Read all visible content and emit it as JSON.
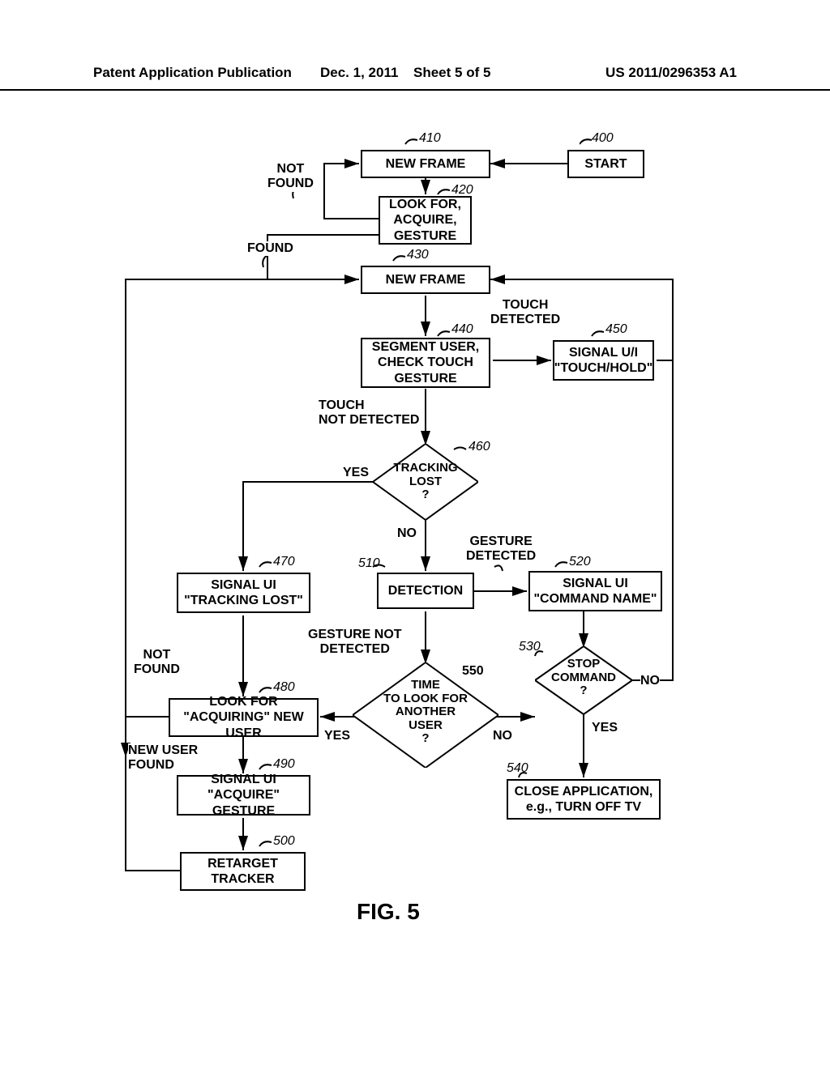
{
  "header": {
    "left": "Patent Application Publication",
    "date": "Dec. 1, 2011",
    "sheet": "Sheet 5 of 5",
    "pubnum": "US 2011/0296353 A1"
  },
  "figure_label": "FIG. 5",
  "nodes": {
    "n400": "START",
    "n410": "NEW FRAME",
    "n420": "LOOK FOR,\nACQUIRE,\nGESTURE",
    "n430": "NEW FRAME",
    "n440": "SEGMENT USER,\nCHECK TOUCH\nGESTURE",
    "n450": "SIGNAL U/I\n\"TOUCH/HOLD\"",
    "n460": "TRACKING\nLOST\n?",
    "n470": "SIGNAL UI\n\"TRACKING LOST\"",
    "n480": "LOOK FOR\n\"ACQUIRING\" NEW USER",
    "n490": "SIGNAL UI\n\"ACQUIRE\" GESTURE",
    "n500": "RETARGET\nTRACKER",
    "n510": "DETECTION",
    "n520": "SIGNAL UI\n\"COMMAND NAME\"",
    "n530": "STOP\nCOMMAND\n?",
    "n540": "CLOSE APPLICATION,\ne.g., TURN OFF TV",
    "n550": "TIME\nTO LOOK FOR\nANOTHER\nUSER\n?"
  },
  "refs": {
    "r400": "400",
    "r410": "410",
    "r420": "420",
    "r430": "430",
    "r440": "440",
    "r450": "450",
    "r460": "460",
    "r470": "470",
    "r480": "480",
    "r490": "490",
    "r500": "500",
    "r510": "510",
    "r520": "520",
    "r530": "530",
    "r540": "540",
    "r550": "550"
  },
  "edge_labels": {
    "not_found": "NOT\nFOUND",
    "found": "FOUND",
    "touch_detected": "TOUCH\nDETECTED",
    "touch_not_detected": "TOUCH\nNOT DETECTED",
    "yes_460": "YES",
    "no_460": "NO",
    "gesture_detected": "GESTURE\nDETECTED",
    "gesture_not_detected": "GESTURE NOT\nDETECTED",
    "not_found_480": "NOT\nFOUND",
    "new_user_found": "NEW USER\nFOUND",
    "no_530": "NO",
    "yes_530": "YES",
    "yes_550": "YES",
    "no_550": "NO"
  }
}
